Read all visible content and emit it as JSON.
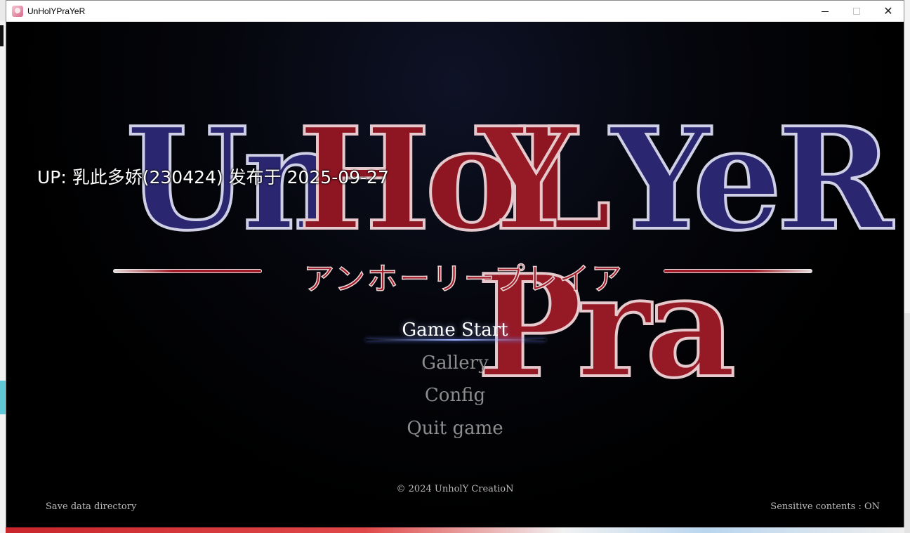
{
  "window": {
    "title": "UnHolYPraYeR",
    "controls": {
      "minimize_icon": "minimize-icon",
      "maximize_icon": "maximize-icon",
      "close_icon": "close-icon"
    }
  },
  "logo": {
    "parts": [
      "Un",
      "HoL",
      "Y Pra",
      "YeR"
    ],
    "subtitle": "アンホーリープレイア"
  },
  "overlay": {
    "uploader_text": "UP: 乳此多娇(230424) 发布于 2025-09-27"
  },
  "menu": {
    "items": [
      "Game Start",
      "Gallery",
      "Config",
      "Quit game"
    ],
    "selected": "Game Start"
  },
  "footer": {
    "copyright": "© 2024 UnholY CreatioN",
    "save_dir": "Save data directory",
    "sensitive": "Sensitive contents : ON"
  },
  "colors": {
    "logo_blue": "#2a2770",
    "logo_red": "#951a26",
    "menu_selected": "#ffffff",
    "menu_normal": "#8d8d8d"
  }
}
